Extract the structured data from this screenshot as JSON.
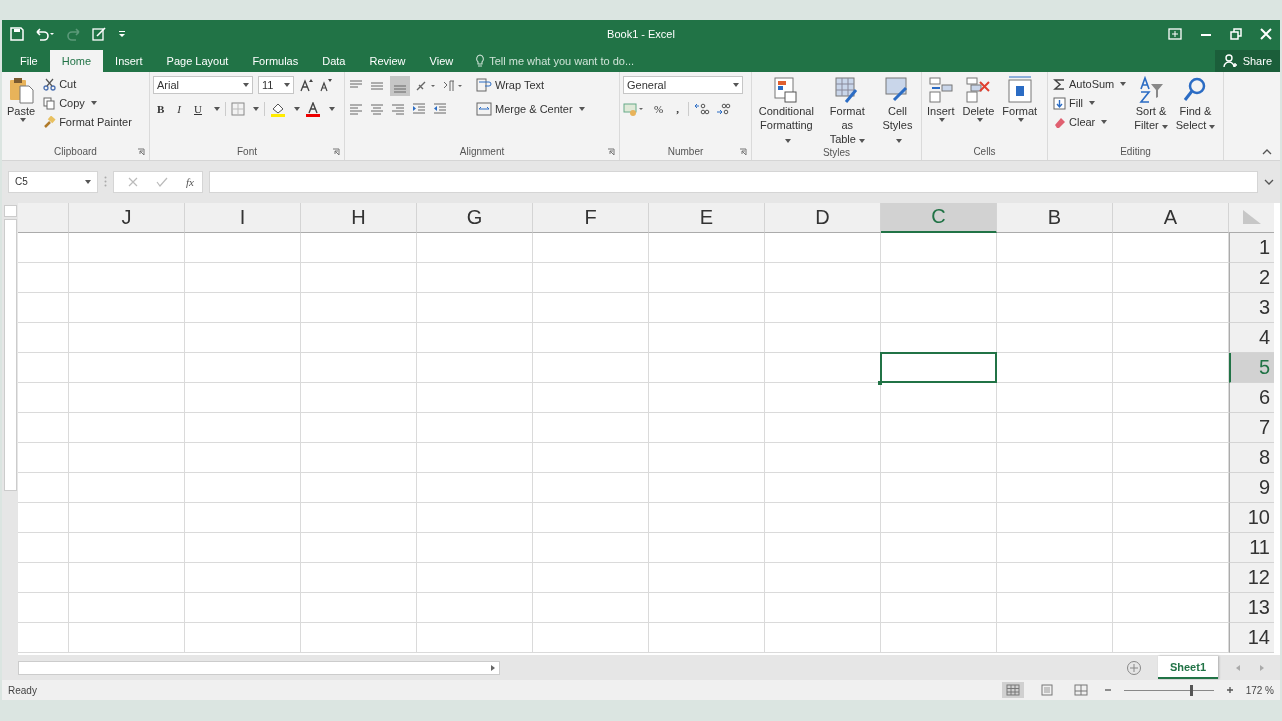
{
  "window": {
    "title": "Book1 - Excel"
  },
  "tabs": [
    {
      "label": "File",
      "selected": false
    },
    {
      "label": "Home",
      "selected": true
    },
    {
      "label": "Insert",
      "selected": false
    },
    {
      "label": "Page Layout",
      "selected": false
    },
    {
      "label": "Formulas",
      "selected": false
    },
    {
      "label": "Data",
      "selected": false
    },
    {
      "label": "Review",
      "selected": false
    },
    {
      "label": "View",
      "selected": false
    }
  ],
  "tell_me": {
    "placeholder": "Tell me what you want to do..."
  },
  "share": "Share",
  "ribbon": {
    "clipboard": {
      "label": "Clipboard",
      "paste": "Paste",
      "cut": "Cut",
      "copy": "Copy",
      "format_painter": "Format Painter"
    },
    "font": {
      "label": "Font",
      "font_name": "Arial",
      "font_size": "11",
      "bold": "B",
      "italic": "I",
      "underline": "U"
    },
    "alignment": {
      "label": "Alignment",
      "wrap_text": "Wrap Text",
      "merge": "Merge & Center"
    },
    "number": {
      "label": "Number",
      "format": "General",
      "percent": "%",
      "comma": ","
    },
    "styles": {
      "label": "Styles",
      "buttons": [
        [
          "Conditional",
          "Formatting"
        ],
        [
          "Format as",
          "Table"
        ],
        [
          "Cell",
          "Styles"
        ]
      ]
    },
    "cells": {
      "label": "Cells",
      "buttons": [
        "Insert",
        "Delete",
        "Format"
      ]
    },
    "editing": {
      "label": "Editing",
      "autosum": "AutoSum",
      "fill": "Fill",
      "clear": "Clear",
      "buttons": [
        [
          "Sort &",
          "Filter"
        ],
        [
          "Find &",
          "Select"
        ]
      ]
    }
  },
  "formula_bar": {
    "name_box": "C5",
    "fx": "fx"
  },
  "columns": [
    {
      "label": "J",
      "selected": false
    },
    {
      "label": "I",
      "selected": false
    },
    {
      "label": "H",
      "selected": false
    },
    {
      "label": "G",
      "selected": false
    },
    {
      "label": "F",
      "selected": false
    },
    {
      "label": "E",
      "selected": false
    },
    {
      "label": "D",
      "selected": false
    },
    {
      "label": "C",
      "selected": true
    },
    {
      "label": "B",
      "selected": false
    },
    {
      "label": "A",
      "selected": false
    }
  ],
  "rows": [
    {
      "label": "1",
      "selected": false
    },
    {
      "label": "2",
      "selected": false
    },
    {
      "label": "3",
      "selected": false
    },
    {
      "label": "4",
      "selected": false
    },
    {
      "label": "5",
      "selected": true
    },
    {
      "label": "6",
      "selected": false
    },
    {
      "label": "7",
      "selected": false
    },
    {
      "label": "8",
      "selected": false
    },
    {
      "label": "9",
      "selected": false
    },
    {
      "label": "10",
      "selected": false
    },
    {
      "label": "11",
      "selected": false
    },
    {
      "label": "12",
      "selected": false
    },
    {
      "label": "13",
      "selected": false
    },
    {
      "label": "14",
      "selected": false
    }
  ],
  "sheets": [
    {
      "label": "Sheet1",
      "selected": true
    }
  ],
  "status_bar": {
    "status": "Ready",
    "zoom": "172 %",
    "views": [
      {
        "kind": "normal",
        "selected": true
      },
      {
        "kind": "page_layout",
        "selected": false
      },
      {
        "kind": "page_break",
        "selected": false
      }
    ],
    "zoom_level": {
      "level": 0.75
    }
  }
}
